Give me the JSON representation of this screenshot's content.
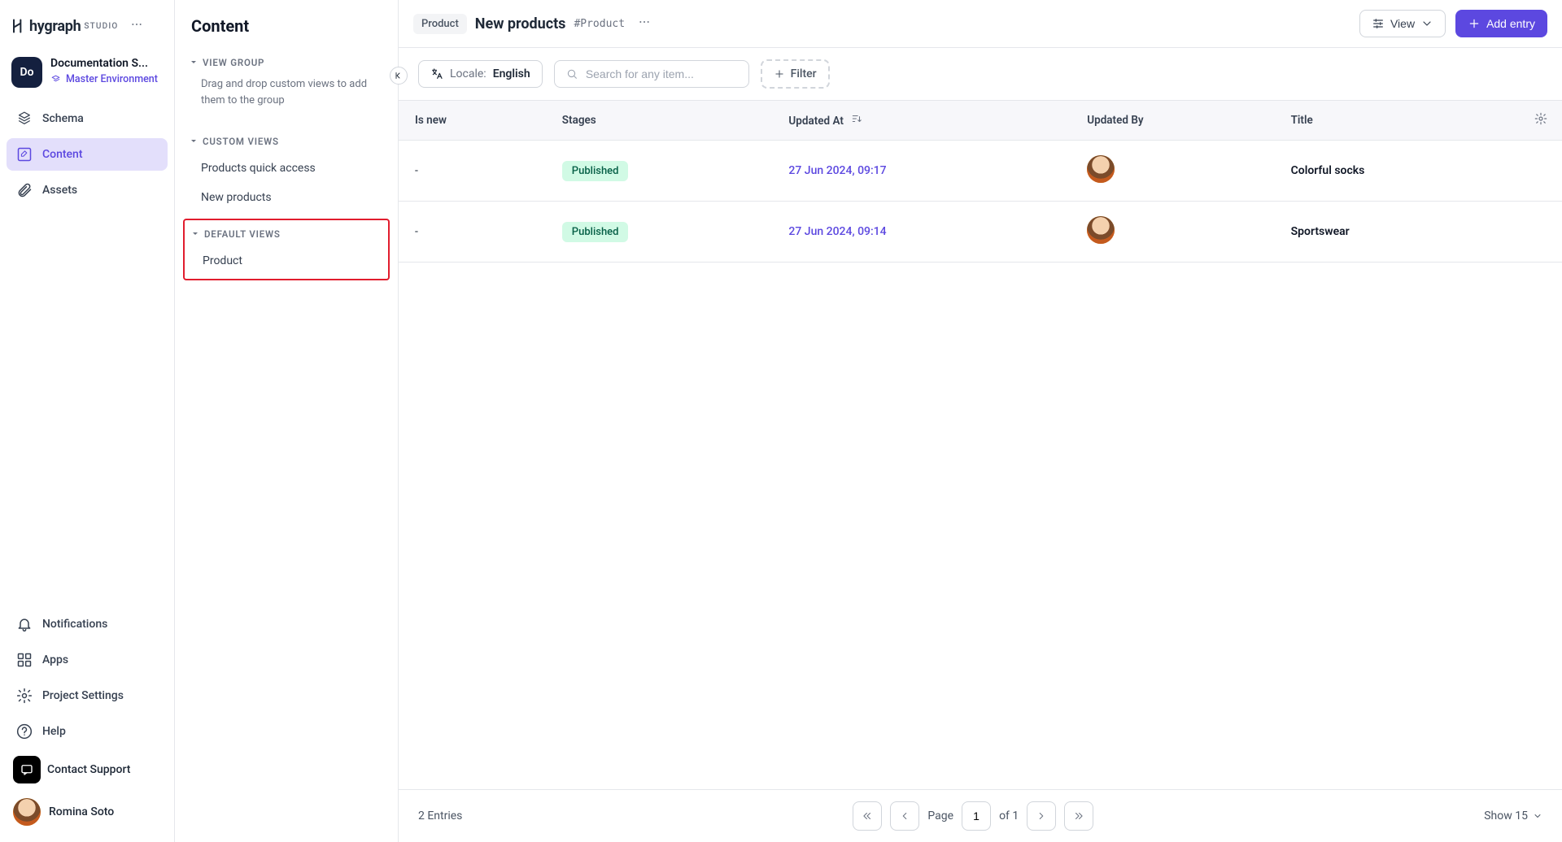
{
  "brand": {
    "name": "hygraph",
    "sub": "STUDIO"
  },
  "project": {
    "avatar": "Do",
    "name": "Documentation S...",
    "environment": "Master Environment"
  },
  "primaryNav": {
    "schema": "Schema",
    "content": "Content",
    "assets": "Assets"
  },
  "bottomNav": {
    "notifications": "Notifications",
    "apps": "Apps",
    "projectSettings": "Project Settings",
    "help": "Help",
    "contactSupport": "Contact Support",
    "userName": "Romina Soto"
  },
  "secondary": {
    "heading": "Content",
    "viewGroup": {
      "label": "VIEW GROUP",
      "desc": "Drag and drop custom views to add them to the group"
    },
    "customViews": {
      "label": "CUSTOM VIEWS",
      "items": [
        "Products quick access",
        "New products"
      ]
    },
    "defaultViews": {
      "label": "DEFAULT VIEWS",
      "items": [
        "Product"
      ]
    }
  },
  "header": {
    "badge": "Product",
    "title": "New products",
    "hash": "#Product",
    "viewBtn": "View",
    "addEntryBtn": "Add entry"
  },
  "filters": {
    "localeLabel": "Locale:",
    "localeValue": "English",
    "searchPlaceholder": "Search for any item...",
    "filterBtn": "Filter"
  },
  "table": {
    "columns": {
      "isNew": "Is new",
      "stages": "Stages",
      "updatedAt": "Updated At",
      "updatedBy": "Updated By",
      "title": "Title"
    },
    "rows": [
      {
        "isNew": "-",
        "stage": "Published",
        "updatedAt": "27 Jun 2024, 09:17",
        "title": "Colorful socks"
      },
      {
        "isNew": "-",
        "stage": "Published",
        "updatedAt": "27 Jun 2024, 09:14",
        "title": "Sportswear"
      }
    ]
  },
  "footer": {
    "count": "2 Entries",
    "pageLabel": "Page",
    "pageValue": "1",
    "ofLabel": "of 1",
    "showLabel": "Show 15"
  }
}
